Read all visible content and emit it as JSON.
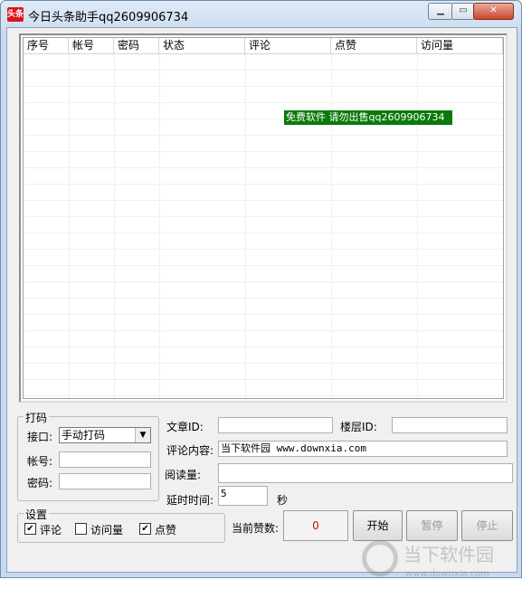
{
  "window": {
    "icon_text": "头条",
    "title": "今日头条助手qq2609906734",
    "min_icon": "minimize-icon",
    "max_icon": "maximize-icon",
    "close_icon": "close-icon"
  },
  "list": {
    "columns": [
      "序号",
      "帐号",
      "密码",
      "状态",
      "评论",
      "点赞",
      "访问量"
    ],
    "rows": [],
    "banner": "免费软件 请勿出售qq2609906734"
  },
  "captcha": {
    "title": "打码",
    "interface_label": "接口:",
    "interface_value": "手动打码",
    "account_label": "帐号:",
    "account_value": "",
    "password_label": "密码:",
    "password_value": ""
  },
  "form": {
    "article_id_label": "文章ID:",
    "article_id_value": "",
    "floor_id_label": "楼层ID:",
    "floor_id_value": "",
    "comment_label": "评论内容:",
    "comment_value": "当下软件园 www.downxia.com",
    "reads_label": "阅读量:",
    "reads_value": "",
    "delay_label": "延时时间:",
    "delay_value": "5",
    "delay_unit": "秒"
  },
  "settings": {
    "title": "设置",
    "options": [
      {
        "label": "评论",
        "checked": true
      },
      {
        "label": "访问量",
        "checked": false
      },
      {
        "label": "点赞",
        "checked": true
      }
    ]
  },
  "status": {
    "likes_label": "当前赞数:",
    "likes_value": "0"
  },
  "buttons": {
    "start": "开始",
    "pause": "暂停",
    "stop": "停止"
  },
  "watermark": {
    "text": "当下软件园",
    "url": "www.downxia.com"
  }
}
